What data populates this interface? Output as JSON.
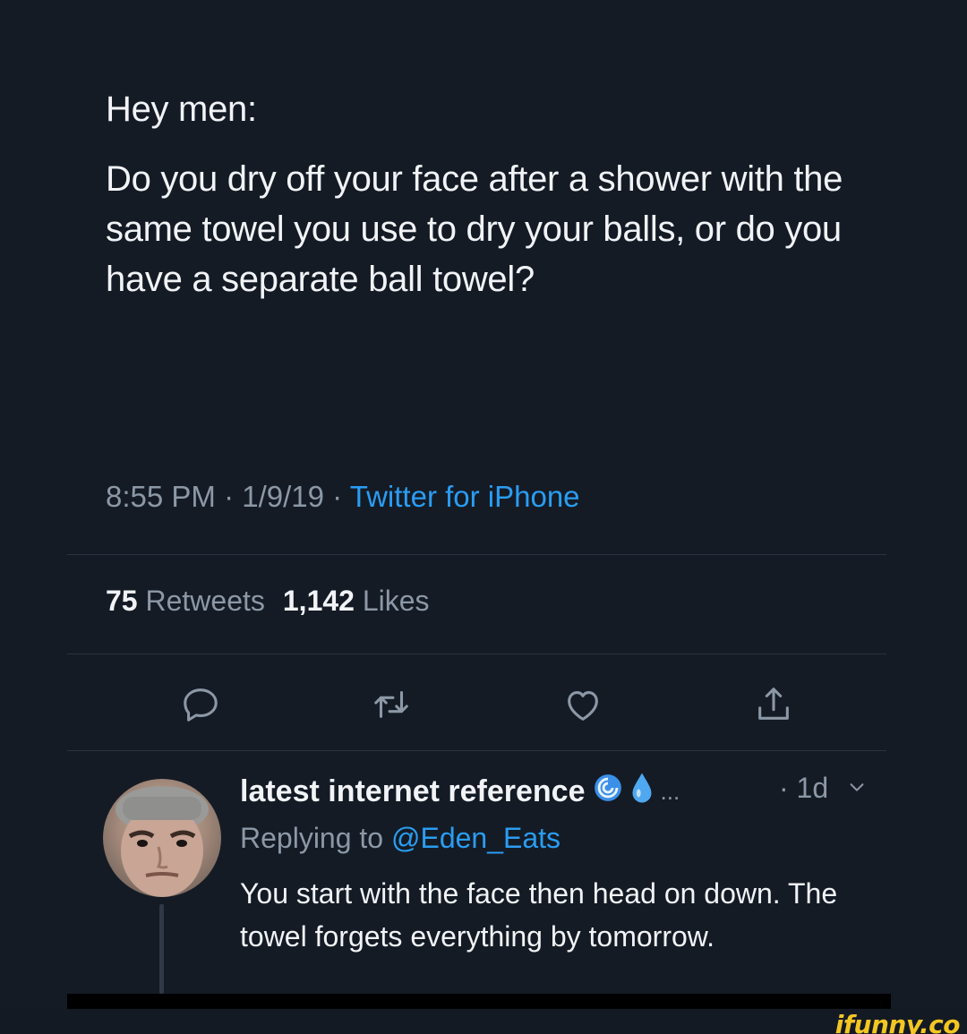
{
  "tweet": {
    "greeting": "Hey men:",
    "body": "Do you dry off your face after a shower with the same towel you use to dry your balls, or do you have a separate ball towel?",
    "time": "8:55 PM",
    "date": "1/9/19",
    "separator": "·",
    "source": "Twitter for iPhone",
    "retweets_count": "75",
    "retweets_label": "Retweets",
    "likes_count": "1,142",
    "likes_label": "Likes"
  },
  "actions": [
    {
      "icon": "reply-icon"
    },
    {
      "icon": "retweet-icon"
    },
    {
      "icon": "like-icon"
    },
    {
      "icon": "share-icon"
    }
  ],
  "reply": {
    "author_name": "latest internet reference",
    "badges": [
      "cyclone-emoji",
      "droplet-emoji"
    ],
    "ellipsis": "...",
    "time": "· 1d",
    "replying_prefix": "Replying to",
    "replying_handle": "@Eden_Eats",
    "text": "You start with the face then head on down. The towel forgets everything by tomorrow."
  },
  "watermark": "ifunny.co",
  "colors": {
    "background": "#141b25",
    "link": "#2a9df2",
    "muted": "#8c98a6",
    "text": "#f1f3f6",
    "watermark": "#f3c622"
  }
}
